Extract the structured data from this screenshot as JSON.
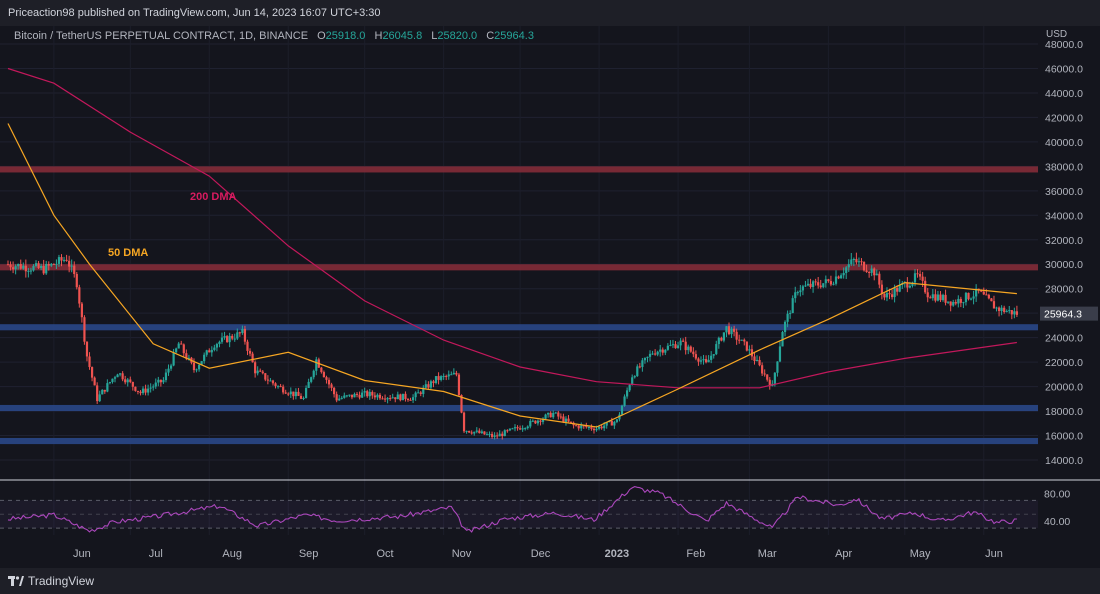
{
  "header": {
    "author": "Priceaction98",
    "published_text": "published on TradingView.com, Jun 14, 2023 16:07 UTC+3:30"
  },
  "symbol": {
    "name": "Bitcoin / TetherUS PERPETUAL CONTRACT, 1D, BINANCE",
    "o_label": "O",
    "o": "25918.0",
    "h_label": "H",
    "h": "26045.8",
    "l_label": "L",
    "l": "25820.0",
    "c_label": "C",
    "c": "25964.3"
  },
  "axis_currency": "USD",
  "footer": {
    "brand": "TradingView"
  },
  "colors": {
    "up": "#26a69a",
    "down": "#ef5350",
    "ma50": "#f6a623",
    "ma200": "#c2185b",
    "res_zone": "#8a2d3a",
    "sup_zone": "#2a4a8e",
    "rsi": "#ab47bc"
  },
  "chart_data": {
    "type": "candlestick",
    "title": "",
    "y_price_ticks": [
      "14000.0",
      "16000.0",
      "18000.0",
      "20000.0",
      "22000.0",
      "24000.0",
      "26000.0",
      "28000.0",
      "30000.0",
      "32000.0",
      "34000.0",
      "36000.0",
      "38000.0",
      "40000.0",
      "42000.0",
      "44000.0",
      "46000.0",
      "48000.0"
    ],
    "ylim": [
      13000,
      48500
    ],
    "x_ticks": [
      "Jun",
      "Jul",
      "Aug",
      "Sep",
      "Oct",
      "Nov",
      "Dec",
      "2023",
      "Feb",
      "Mar",
      "Apr",
      "May",
      "Jun"
    ],
    "last_price": "25964.3",
    "annotations": [
      {
        "text": "200 DMA",
        "color": "#d81b60"
      },
      {
        "text": "50 DMA",
        "color": "#f6a623"
      }
    ],
    "zones": [
      {
        "type": "resistance",
        "from": 37500,
        "to": 38000
      },
      {
        "type": "resistance",
        "from": 29500,
        "to": 30000
      },
      {
        "type": "support",
        "from": 24600,
        "to": 25100
      },
      {
        "type": "support",
        "from": 18000,
        "to": 18500
      },
      {
        "type": "support",
        "from": 15300,
        "to": 15800
      }
    ],
    "price_path": [
      [
        "2022-05-14",
        30000
      ],
      [
        "2022-05-28",
        29600
      ],
      [
        "2022-06-06",
        30500
      ],
      [
        "2022-06-10",
        28500
      ],
      [
        "2022-06-14",
        22500
      ],
      [
        "2022-06-18",
        19000
      ],
      [
        "2022-06-26",
        21200
      ],
      [
        "2022-07-05",
        19500
      ],
      [
        "2022-07-14",
        20500
      ],
      [
        "2022-07-20",
        23500
      ],
      [
        "2022-07-26",
        21400
      ],
      [
        "2022-08-03",
        23500
      ],
      [
        "2022-08-14",
        24400
      ],
      [
        "2022-08-19",
        21300
      ],
      [
        "2022-08-28",
        20000
      ],
      [
        "2022-09-07",
        19000
      ],
      [
        "2022-09-12",
        22200
      ],
      [
        "2022-09-20",
        19000
      ],
      [
        "2022-09-30",
        19400
      ],
      [
        "2022-10-10",
        19200
      ],
      [
        "2022-10-20",
        19100
      ],
      [
        "2022-10-29",
        20600
      ],
      [
        "2022-11-06",
        21000
      ],
      [
        "2022-11-09",
        16500
      ],
      [
        "2022-11-21",
        15900
      ],
      [
        "2022-12-05",
        17000
      ],
      [
        "2022-12-14",
        17800
      ],
      [
        "2022-12-22",
        16800
      ],
      [
        "2022-12-31",
        16600
      ],
      [
        "2023-01-08",
        17200
      ],
      [
        "2023-01-14",
        20900
      ],
      [
        "2023-01-22",
        22800
      ],
      [
        "2023-02-02",
        23600
      ],
      [
        "2023-02-12",
        21800
      ],
      [
        "2023-02-20",
        24800
      ],
      [
        "2023-02-28",
        23200
      ],
      [
        "2023-03-10",
        20000
      ],
      [
        "2023-03-14",
        24600
      ],
      [
        "2023-03-20",
        28000
      ],
      [
        "2023-04-02",
        28600
      ],
      [
        "2023-04-11",
        30300
      ],
      [
        "2023-04-19",
        29400
      ],
      [
        "2023-04-23",
        27300
      ],
      [
        "2023-05-06",
        29000
      ],
      [
        "2023-05-10",
        27600
      ],
      [
        "2023-05-20",
        26900
      ],
      [
        "2023-05-30",
        27700
      ],
      [
        "2023-06-06",
        26400
      ],
      [
        "2023-06-14",
        25964
      ]
    ],
    "ma50": [
      [
        "2022-05-14",
        41500
      ],
      [
        "2022-06-01",
        34000
      ],
      [
        "2022-06-15",
        30000
      ],
      [
        "2022-07-10",
        23500
      ],
      [
        "2022-08-01",
        21500
      ],
      [
        "2022-09-01",
        22800
      ],
      [
        "2022-10-01",
        20500
      ],
      [
        "2022-11-01",
        19600
      ],
      [
        "2022-12-01",
        17600
      ],
      [
        "2022-12-31",
        16700
      ],
      [
        "2023-02-01",
        19800
      ],
      [
        "2023-03-05",
        23000
      ],
      [
        "2023-04-01",
        25500
      ],
      [
        "2023-05-01",
        28500
      ],
      [
        "2023-06-14",
        27600
      ]
    ],
    "ma200": [
      [
        "2022-05-14",
        46000
      ],
      [
        "2022-06-01",
        44800
      ],
      [
        "2022-07-01",
        40800
      ],
      [
        "2022-08-01",
        37200
      ],
      [
        "2022-09-01",
        31500
      ],
      [
        "2022-10-01",
        27000
      ],
      [
        "2022-11-01",
        23800
      ],
      [
        "2022-12-01",
        21600
      ],
      [
        "2022-12-31",
        20400
      ],
      [
        "2023-02-01",
        19900
      ],
      [
        "2023-03-05",
        19900
      ],
      [
        "2023-04-01",
        21200
      ],
      [
        "2023-05-01",
        22300
      ],
      [
        "2023-06-14",
        23600
      ]
    ],
    "rsi": {
      "ticks": [
        "80.00",
        "40.00"
      ],
      "ylim": [
        20,
        95
      ],
      "band": [
        30,
        70
      ],
      "path": [
        [
          "2022-05-14",
          43
        ],
        [
          "2022-06-01",
          49
        ],
        [
          "2022-06-15",
          26
        ],
        [
          "2022-06-25",
          39
        ],
        [
          "2022-07-10",
          46
        ],
        [
          "2022-08-05",
          62
        ],
        [
          "2022-08-20",
          33
        ],
        [
          "2022-09-08",
          49
        ],
        [
          "2022-09-20",
          41
        ],
        [
          "2022-10-15",
          47
        ],
        [
          "2022-11-04",
          60
        ],
        [
          "2022-11-10",
          24
        ],
        [
          "2022-11-25",
          43
        ],
        [
          "2022-12-15",
          52
        ],
        [
          "2022-12-30",
          42
        ],
        [
          "2023-01-14",
          89
        ],
        [
          "2023-01-25",
          80
        ],
        [
          "2023-02-12",
          40
        ],
        [
          "2023-02-20",
          66
        ],
        [
          "2023-03-10",
          30
        ],
        [
          "2023-03-20",
          75
        ],
        [
          "2023-04-05",
          63
        ],
        [
          "2023-04-12",
          72
        ],
        [
          "2023-04-22",
          43
        ],
        [
          "2023-05-05",
          52
        ],
        [
          "2023-05-15",
          40
        ],
        [
          "2023-05-28",
          53
        ],
        [
          "2023-06-06",
          38
        ],
        [
          "2023-06-14",
          41
        ]
      ]
    }
  }
}
